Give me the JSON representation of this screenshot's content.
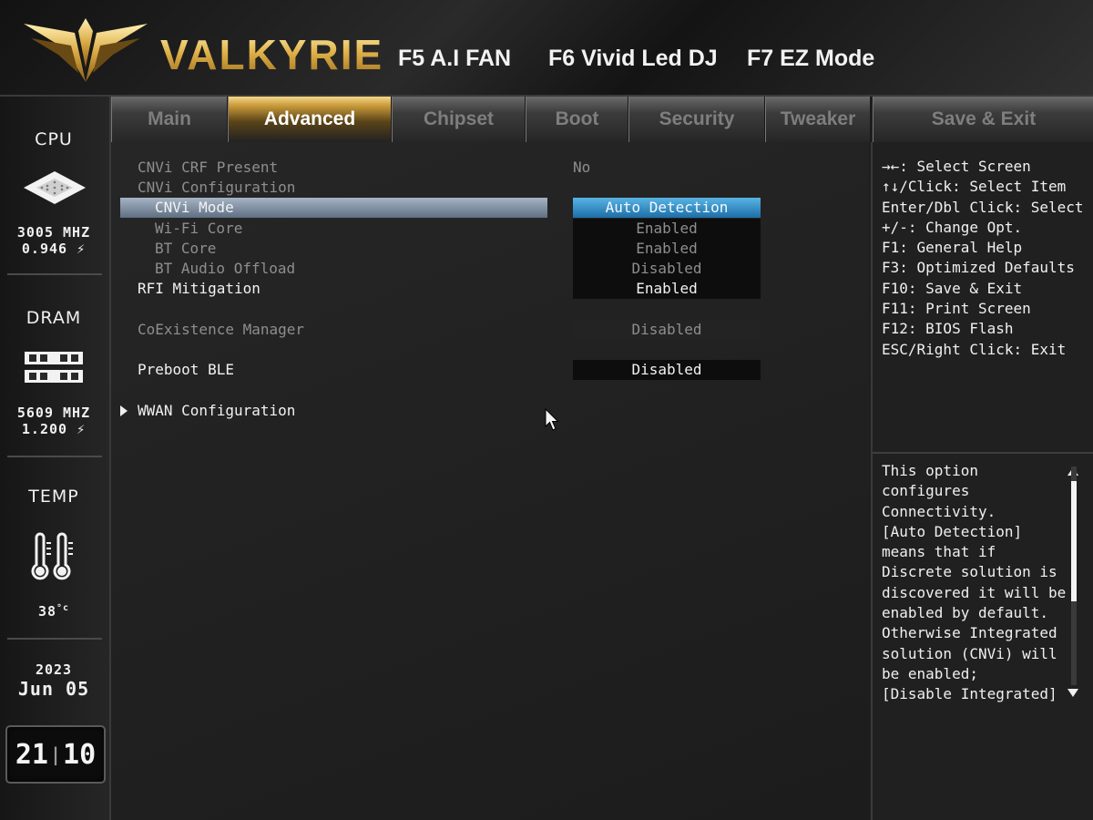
{
  "header": {
    "brand": "VALKYRIE",
    "fkeys": [
      "F5 A.I FAN",
      "F6 Vivid Led DJ",
      "F7 EZ Mode"
    ]
  },
  "sidebar": {
    "cpu": {
      "label": "CPU",
      "freq": "3005 MHZ",
      "volt": "0.946"
    },
    "dram": {
      "label": "DRAM",
      "freq": "5609 MHZ",
      "volt": "1.200"
    },
    "temp": {
      "label": "TEMP",
      "value": "38"
    },
    "date": {
      "year": "2023",
      "day": "Jun 05"
    },
    "clock": {
      "hour": "21",
      "minute": "10"
    }
  },
  "tabs": [
    "Main",
    "Advanced",
    "Chipset",
    "Boot",
    "Security",
    "Tweaker"
  ],
  "active_tab": "Advanced",
  "save_tab": "Save & Exit",
  "settings": [
    {
      "label": "CNVi CRF Present",
      "value": "No"
    },
    {
      "label": "CNVi Configuration"
    },
    {
      "label": "CNVi Mode",
      "value": "Auto Detection"
    },
    {
      "label": "Wi-Fi Core",
      "value": "Enabled"
    },
    {
      "label": "BT Core",
      "value": "Enabled"
    },
    {
      "label": "BT Audio Offload",
      "value": "Disabled"
    },
    {
      "label": "RFI Mitigation",
      "value": "Enabled"
    },
    {
      "label": "CoExistence Manager",
      "value": "Disabled"
    },
    {
      "label": "Preboot BLE",
      "value": "Disabled"
    },
    {
      "label": "WWAN Configuration"
    }
  ],
  "key_help": [
    "→←: Select Screen",
    "↑↓/Click: Select Item",
    "Enter/Dbl Click: Select",
    "+/-: Change Opt.",
    "F1: General Help",
    "F3: Optimized Defaults",
    "F10: Save & Exit",
    "F11: Print Screen",
    "F12: BIOS Flash",
    "ESC/Right Click: Exit"
  ],
  "help_text": [
    "This option",
    "configures",
    "Connectivity.",
    "[Auto Detection]",
    "means that if",
    "Discrete solution is",
    "discovered it will be",
    "enabled by default.",
    "Otherwise Integrated",
    "solution (CNVi) will",
    "be enabled;",
    "[Disable Integrated]"
  ],
  "colors": {
    "accent_gold": "#d6a53c",
    "selected_value": "#2a86c4",
    "selected_bar": "#8090a4"
  }
}
